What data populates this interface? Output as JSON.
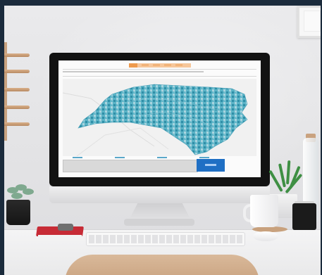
{
  "scene": {
    "subject": "desk-with-monitor",
    "icons": [
      "monitor-icon",
      "plant-icon",
      "mug-icon",
      "keyboard-icon",
      "mouse-icon",
      "notebook-icon",
      "bottle-icon"
    ]
  },
  "map": {
    "region_fill": "#5bb3c6",
    "region_fill_dark": "#2f8fa8",
    "region_fill_light": "#a9d4df",
    "accent_tab": "#ee9a4d",
    "button": "#1f6fc4"
  },
  "colors": {
    "background": "#1b2b3c",
    "wall": "#e6e6e8",
    "desk": "#f1f1f2",
    "chair": "#d3b08f",
    "notebook": "#c72b36"
  }
}
